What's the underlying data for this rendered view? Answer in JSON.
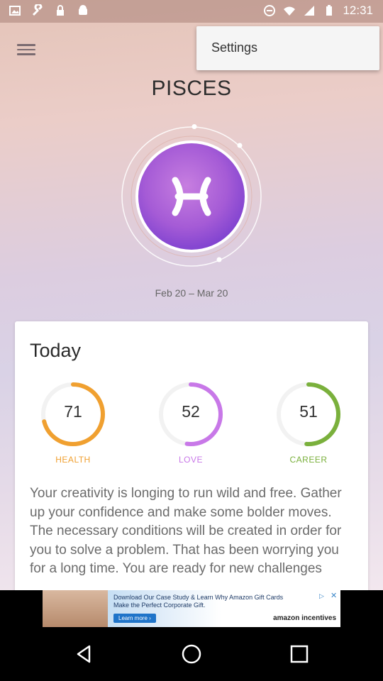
{
  "status_bar": {
    "time": "12:31",
    "left_icons": [
      "image-icon",
      "wrench-icon",
      "lock-icon",
      "android-icon"
    ],
    "right_icons": [
      "dnd-icon",
      "wifi-icon",
      "signal-icon",
      "battery-icon"
    ]
  },
  "header": {
    "menu_icon": "hamburger-icon",
    "title": "PISCES"
  },
  "overflow_menu": {
    "items": [
      {
        "label": "Settings"
      }
    ]
  },
  "sign": {
    "symbol": "♓",
    "date_range": "Feb 20 – Mar 20",
    "colors": {
      "inner": "#b257d8",
      "outer": "#7a3fcf"
    }
  },
  "today_card": {
    "heading": "Today",
    "stats": [
      {
        "label": "HEALTH",
        "value": "71",
        "fraction": 0.71,
        "color": "#f0a030"
      },
      {
        "label": "LOVE",
        "value": "52",
        "fraction": 0.52,
        "color": "#c878e8"
      },
      {
        "label": "CAREER",
        "value": "51",
        "fraction": 0.51,
        "color": "#7ab03c"
      }
    ],
    "description": "Your creativity is longing to run wild and free. Gather up your confidence and make some bolder moves. The necessary conditions will be created in order for you to solve a problem. That has been worrying you for a long time. You are ready for new challenges"
  },
  "ad_banner": {
    "text": "Download Our Case Study & Learn Why Amazon Gift Cards Make the Perfect Corporate Gift.",
    "button": "Learn more ›",
    "brand": "amazon incentives"
  },
  "nav_bar": {
    "buttons": [
      "back-icon",
      "home-icon",
      "recents-icon"
    ]
  }
}
